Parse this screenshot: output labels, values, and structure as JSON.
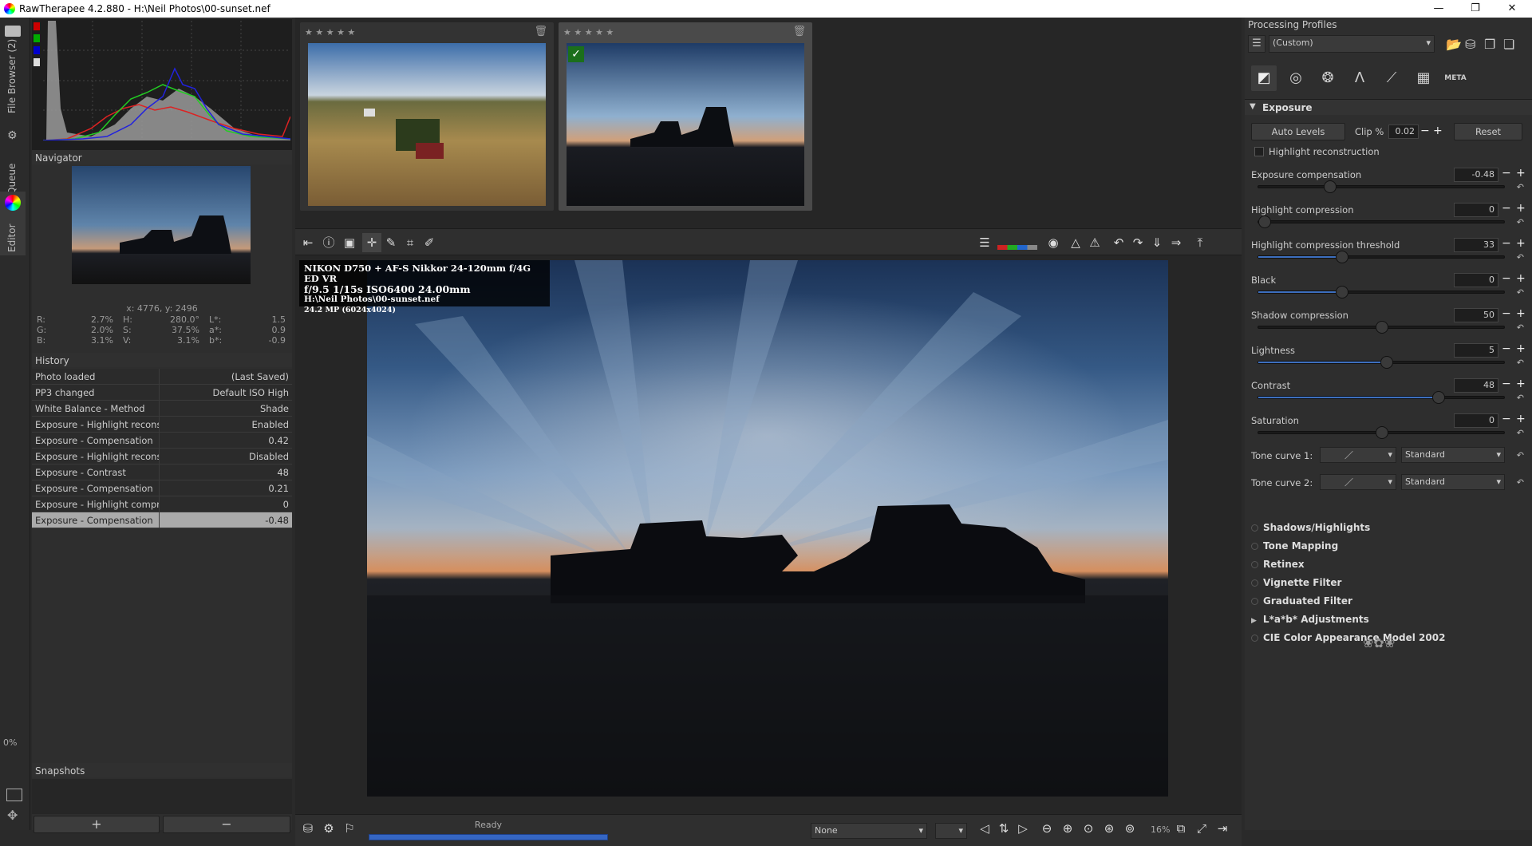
{
  "window": {
    "title": "RawTherapee 4.2.880 - H:\\Neil Photos\\00-sunset.nef",
    "minimize": "—",
    "maximize": "❐",
    "close": "✕"
  },
  "left_tabs": {
    "file_browser": "File Browser (2)",
    "queue": "Queue",
    "editor": "Editor",
    "zoom_pct": "0%"
  },
  "navigator": {
    "title": "Navigator",
    "coords": "x: 4776, y: 2496",
    "rows": [
      {
        "k1": "R:",
        "v1": "2.7%",
        "k2": "H:",
        "v2": "280.0°",
        "k3": "L*:",
        "v3": "1.5"
      },
      {
        "k1": "G:",
        "v1": "2.0%",
        "k2": "S:",
        "v2": "37.5%",
        "k3": "a*:",
        "v3": "0.9"
      },
      {
        "k1": "B:",
        "v1": "3.1%",
        "k2": "V:",
        "v2": "3.1%",
        "k3": "b*:",
        "v3": "-0.9"
      }
    ]
  },
  "history": {
    "title": "History",
    "rows": [
      {
        "action": "Photo loaded",
        "value": "(Last Saved)"
      },
      {
        "action": "PP3 changed",
        "value": "Default ISO High"
      },
      {
        "action": "White Balance - Method",
        "value": "Shade"
      },
      {
        "action": "Exposure - Highlight recons",
        "value": "Enabled"
      },
      {
        "action": "Exposure - Compensation",
        "value": "0.42"
      },
      {
        "action": "Exposure - Highlight recons",
        "value": "Disabled"
      },
      {
        "action": "Exposure - Contrast",
        "value": "48"
      },
      {
        "action": "Exposure - Compensation",
        "value": "0.21"
      },
      {
        "action": "Exposure - Highlight compr",
        "value": "0"
      },
      {
        "action": "Exposure - Compensation",
        "value": "-0.48"
      }
    ]
  },
  "snapshots": {
    "title": "Snapshots",
    "add": "+",
    "remove": "−"
  },
  "thumbs": [
    {
      "stars": "★ ★ ★ ★ ★"
    },
    {
      "stars": "★ ★ ★ ★ ★"
    }
  ],
  "exif": {
    "line1": "NIKON D750 + AF-S Nikkor 24-120mm f/4G ED VR",
    "line2": "f/9.5  1/15s  ISO6400  24.00mm",
    "line3": "H:\\Neil Photos\\00-sunset.nef",
    "line4": "24.2 MP (6024x4024)"
  },
  "status": {
    "ready": "Ready",
    "progress": 1.0,
    "preview_select": "None",
    "zoom": "16%"
  },
  "profiles": {
    "title": "Processing Profiles",
    "selected": "(Custom)"
  },
  "tool_tabs": [
    "exposure-tab",
    "detail-tab",
    "color-tab",
    "advanced-tab",
    "transform-tab",
    "raw-tab",
    "META"
  ],
  "exposure": {
    "title": "Exposure",
    "auto_levels": "Auto Levels",
    "clip_label": "Clip %",
    "clip_value": "0.02",
    "reset": "Reset",
    "highlight_recon": "Highlight reconstruction",
    "sliders": [
      {
        "label": "Exposure compensation",
        "value": "-0.48",
        "pos": 0.28,
        "fill": false
      },
      {
        "label": "Highlight compression",
        "value": "0",
        "pos": 0.0,
        "fill": false
      },
      {
        "label": "Highlight compression threshold",
        "value": "33",
        "pos": 0.33,
        "fill": true
      },
      {
        "label": "Black",
        "value": "0",
        "pos": 0.33,
        "fill": true
      },
      {
        "label": "Shadow compression",
        "value": "50",
        "pos": 0.5,
        "fill": false
      },
      {
        "label": "Lightness",
        "value": "5",
        "pos": 0.52,
        "fill": true
      },
      {
        "label": "Contrast",
        "value": "48",
        "pos": 0.74,
        "fill": true
      },
      {
        "label": "Saturation",
        "value": "0",
        "pos": 0.5,
        "fill": false
      }
    ],
    "tone_curve_1": "Tone curve 1:",
    "tone_curve_2": "Tone curve 2:",
    "curve_mode": "Standard"
  },
  "tools": [
    {
      "name": "Shadows/Highlights",
      "marker": "dot"
    },
    {
      "name": "Tone Mapping",
      "marker": "dot"
    },
    {
      "name": "Retinex",
      "marker": "dot"
    },
    {
      "name": "Vignette Filter",
      "marker": "dot"
    },
    {
      "name": "Graduated Filter",
      "marker": "dot"
    },
    {
      "name": "L*a*b* Adjustments",
      "marker": "arrow"
    },
    {
      "name": "CIE Color Appearance Model 2002",
      "marker": "dot"
    }
  ]
}
